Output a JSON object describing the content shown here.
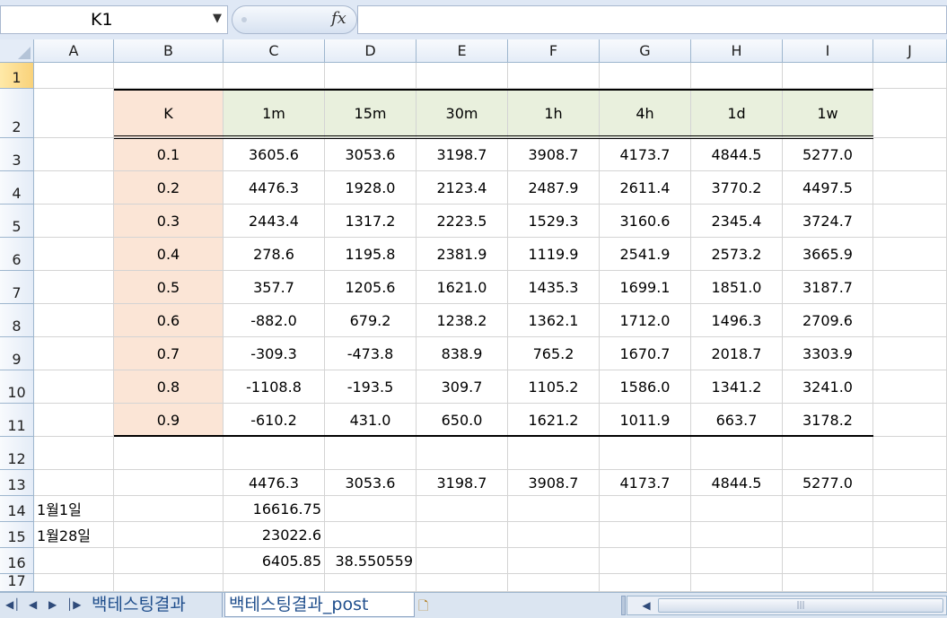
{
  "formula_bar": {
    "name_box": "K1",
    "name_box_arrow": "▼",
    "fx_label": "fx",
    "formula_value": ""
  },
  "columns": [
    "A",
    "B",
    "C",
    "D",
    "E",
    "F",
    "G",
    "H",
    "I",
    "J"
  ],
  "rows": [
    "1",
    "2",
    "3",
    "4",
    "5",
    "6",
    "7",
    "8",
    "9",
    "10",
    "11",
    "12",
    "13",
    "14",
    "15",
    "16",
    "17"
  ],
  "active_row": "1",
  "table": {
    "k_label": "K",
    "headers": [
      "1m",
      "15m",
      "30m",
      "1h",
      "4h",
      "1d",
      "1w"
    ],
    "k_values": [
      "0.1",
      "0.2",
      "0.3",
      "0.4",
      "0.5",
      "0.6",
      "0.7",
      "0.8",
      "0.9"
    ],
    "values": [
      [
        "3605.6",
        "3053.6",
        "3198.7",
        "3908.7",
        "4173.7",
        "4844.5",
        "5277.0"
      ],
      [
        "4476.3",
        "1928.0",
        "2123.4",
        "2487.9",
        "2611.4",
        "3770.2",
        "4497.5"
      ],
      [
        "2443.4",
        "1317.2",
        "2223.5",
        "1529.3",
        "3160.6",
        "2345.4",
        "3724.7"
      ],
      [
        "278.6",
        "1195.8",
        "2381.9",
        "1119.9",
        "2541.9",
        "2573.2",
        "3665.9"
      ],
      [
        "357.7",
        "1205.6",
        "1621.0",
        "1435.3",
        "1699.1",
        "1851.0",
        "3187.7"
      ],
      [
        "-882.0",
        "679.2",
        "1238.2",
        "1362.1",
        "1712.0",
        "1496.3",
        "2709.6"
      ],
      [
        "-309.3",
        "-473.8",
        "838.9",
        "765.2",
        "1670.7",
        "2018.7",
        "3303.9"
      ],
      [
        "-1108.8",
        "-193.5",
        "309.7",
        "1105.2",
        "1586.0",
        "1341.2",
        "3241.0"
      ],
      [
        "-610.2",
        "431.0",
        "650.0",
        "1621.2",
        "1011.9",
        "663.7",
        "3178.2"
      ]
    ]
  },
  "row13": [
    "4476.3",
    "3053.6",
    "3198.7",
    "3908.7",
    "4173.7",
    "4844.5",
    "5277.0"
  ],
  "row14": {
    "a": "1월1일",
    "c": "16616.75"
  },
  "row15": {
    "a": "1월28일",
    "c": "23022.6"
  },
  "row16": {
    "c": "6405.85",
    "d": "38.550559"
  },
  "sheet_tabs": [
    "백테스팅결과",
    "백테스팅결과_post"
  ],
  "active_tab": "백테스팅결과_post",
  "nav_icons": [
    "first-sheet-icon",
    "prev-sheet-icon",
    "next-sheet-icon",
    "last-sheet-icon"
  ]
}
